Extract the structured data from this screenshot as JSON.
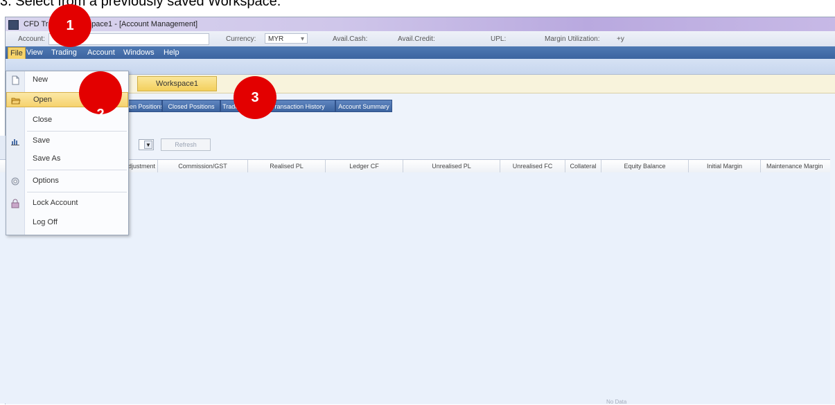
{
  "caption": "3. Select from a previously saved Workspace.",
  "window": {
    "title": "CFD Trader - Workspace1 - [Account Management]"
  },
  "infobar": {
    "account_label": "Account:",
    "currency_label": "Currency:",
    "currency_value": "MYR",
    "avail_cash_label": "Avail.Cash:",
    "avail_credit_label": "Avail.Credit:",
    "upl_label": "UPL:",
    "margin_label": "Margin Utilization:",
    "margin_value": "+y"
  },
  "menubar": {
    "items": [
      "File",
      "View",
      "Trading",
      "Account",
      "Windows",
      "Help"
    ]
  },
  "file_menu": {
    "items": [
      "New",
      "Open",
      "Close",
      "Save",
      "Save As",
      "Options",
      "Lock Account",
      "Log Off"
    ]
  },
  "workspace_tab": "Workspace1",
  "tabs": [
    "Open Positions",
    "Closed Positions",
    "Trades Done",
    "Transaction History",
    "Account Summary"
  ],
  "refresh_label": "Refresh",
  "grid": {
    "columns": [
      "Adjustment",
      "Commission/GST",
      "Realised PL",
      "Ledger CF",
      "Unrealised PL",
      "Unrealised FC",
      "Collateral",
      "Equity Balance",
      "Initial Margin",
      "Maintenance Margin"
    ],
    "empty_text": "No Data"
  },
  "badges": [
    "1",
    "2",
    "3"
  ],
  "colors": {
    "menubar": "#3d64a0",
    "highlight": "#f6d26d",
    "badge": "#e30000"
  }
}
